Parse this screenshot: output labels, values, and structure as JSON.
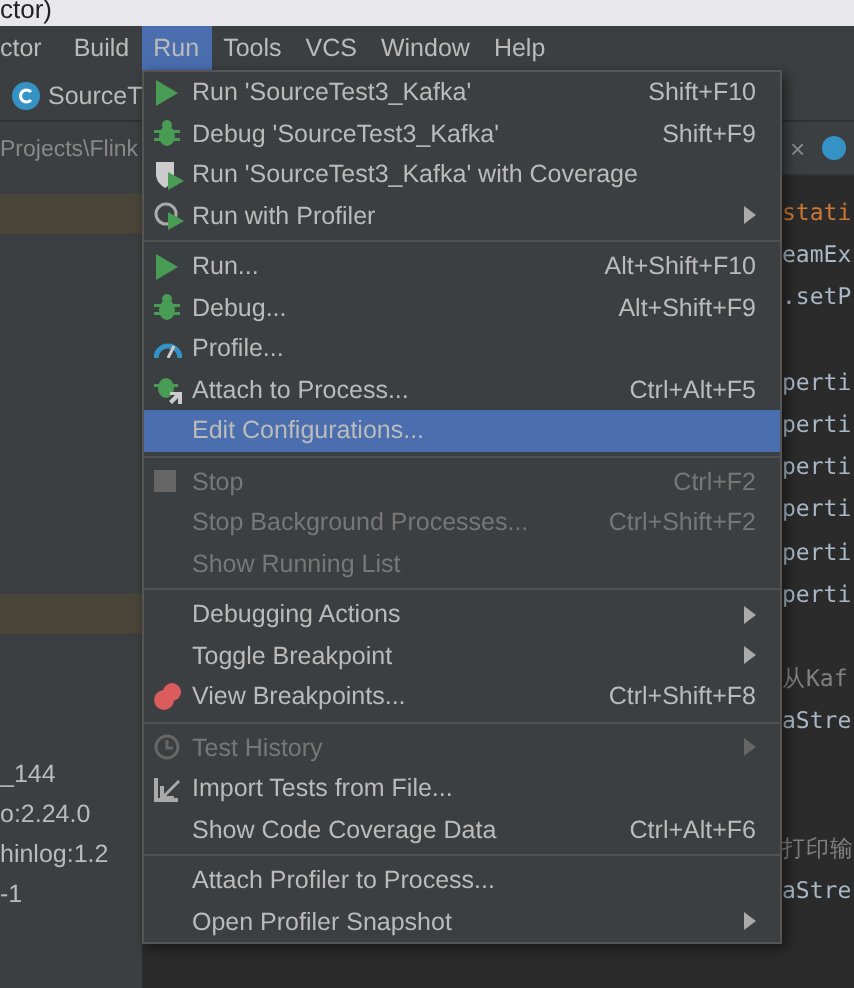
{
  "title_bar": {
    "text": "ctor)"
  },
  "menu_bar": [
    {
      "label": "ctor",
      "selected": false
    },
    {
      "label": "Build",
      "selected": false
    },
    {
      "label": "Run",
      "selected": true
    },
    {
      "label": "Tools",
      "selected": false
    },
    {
      "label": "VCS",
      "selected": false
    },
    {
      "label": "Window",
      "selected": false
    },
    {
      "label": "Help",
      "selected": false
    }
  ],
  "toolbar": {
    "run_config": "SourceT"
  },
  "editor_tab": {
    "close": "×"
  },
  "project_panel": {
    "path": "Projects\\Flink",
    "lines": [
      "_144",
      "o:2.24.0",
      "hinlog:1.2",
      "-1"
    ]
  },
  "code_lines": [
    {
      "text": "stati",
      "kind": "keyword"
    },
    {
      "text": "eamEx",
      "kind": "code"
    },
    {
      "text": ".setP",
      "kind": "code"
    },
    {
      "kind": "blank"
    },
    {
      "text": "perti",
      "kind": "code"
    },
    {
      "text": "perti",
      "kind": "code"
    },
    {
      "text": "perti",
      "kind": "code"
    },
    {
      "text": "perti",
      "kind": "code"
    },
    {
      "text": "perti",
      "kind": "code"
    },
    {
      "text": "perti",
      "kind": "code"
    },
    {
      "kind": "blank"
    },
    {
      "text": "从Kaf",
      "kind": "comment"
    },
    {
      "text": "aStre",
      "kind": "code"
    },
    {
      "kind": "blank"
    },
    {
      "kind": "blank"
    },
    {
      "text": "打印输",
      "kind": "comment"
    },
    {
      "text": "aStre",
      "kind": "code"
    }
  ],
  "run_menu": {
    "sections": [
      [
        {
          "kind": "run",
          "label": "Run 'SourceTest3_Kafka'",
          "shortcut": "Shift+F10",
          "disabled": false,
          "selected": false,
          "submenu": false
        },
        {
          "kind": "debug",
          "label": "Debug 'SourceTest3_Kafka'",
          "shortcut": "Shift+F9",
          "disabled": false,
          "selected": false,
          "submenu": false
        },
        {
          "kind": "coverage",
          "label": "Run 'SourceTest3_Kafka' with Coverage",
          "disabled": false,
          "selected": false,
          "submenu": false
        },
        {
          "kind": "profiler",
          "label": "Run with Profiler",
          "disabled": false,
          "selected": false,
          "submenu": true
        }
      ],
      [
        {
          "kind": "run",
          "label": "Run...",
          "shortcut": "Alt+Shift+F10",
          "disabled": false,
          "selected": false,
          "submenu": false
        },
        {
          "kind": "debug",
          "label": "Debug...",
          "shortcut": "Alt+Shift+F9",
          "disabled": false,
          "selected": false,
          "submenu": false
        },
        {
          "kind": "profile",
          "label": "Profile...",
          "disabled": false,
          "selected": false,
          "submenu": false
        },
        {
          "kind": "attach",
          "label": "Attach to Process...",
          "shortcut": "Ctrl+Alt+F5",
          "disabled": false,
          "selected": false,
          "submenu": false
        },
        {
          "kind": "plain",
          "label": "Edit Configurations...",
          "disabled": false,
          "selected": true,
          "submenu": false
        }
      ],
      [
        {
          "kind": "stop",
          "label": "Stop",
          "shortcut": "Ctrl+F2",
          "disabled": true,
          "selected": false,
          "submenu": false
        },
        {
          "kind": "plain",
          "label": "Stop Background Processes...",
          "shortcut": "Ctrl+Shift+F2",
          "disabled": true,
          "selected": false,
          "submenu": false
        },
        {
          "kind": "plain",
          "label": "Show Running List",
          "disabled": true,
          "selected": false,
          "submenu": false
        }
      ],
      [
        {
          "kind": "plain",
          "label": "Debugging Actions",
          "disabled": false,
          "selected": false,
          "submenu": true
        },
        {
          "kind": "plain",
          "label": "Toggle Breakpoint",
          "disabled": false,
          "selected": false,
          "submenu": true
        },
        {
          "kind": "breakpoints",
          "label": "View Breakpoints...",
          "shortcut": "Ctrl+Shift+F8",
          "disabled": false,
          "selected": false,
          "submenu": false
        }
      ],
      [
        {
          "kind": "history",
          "label": "Test History",
          "disabled": true,
          "selected": false,
          "submenu": true
        },
        {
          "kind": "import",
          "label": "Import Tests from File...",
          "disabled": false,
          "selected": false,
          "submenu": false
        },
        {
          "kind": "plain",
          "label": "Show Code Coverage Data",
          "shortcut": "Ctrl+Alt+F6",
          "disabled": false,
          "selected": false,
          "submenu": false
        }
      ],
      [
        {
          "kind": "plain",
          "label": "Attach Profiler to Process...",
          "disabled": false,
          "selected": false,
          "submenu": false
        },
        {
          "kind": "plain",
          "label": "Open Profiler Snapshot",
          "disabled": false,
          "selected": false,
          "submenu": true
        }
      ]
    ]
  }
}
